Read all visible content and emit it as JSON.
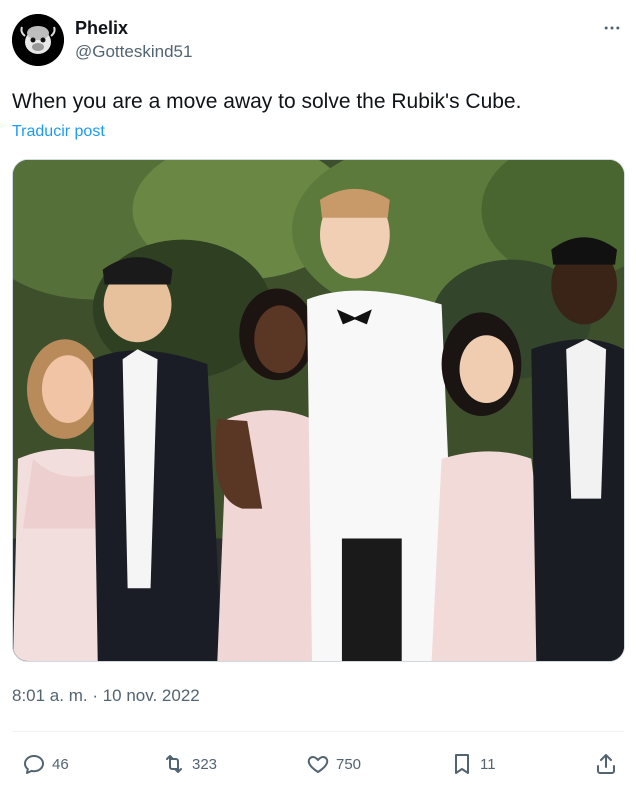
{
  "author": {
    "name": "Phelix",
    "handle": "@Gotteskind51",
    "avatar_icon": "gorilla-icon"
  },
  "tweet": {
    "text": "When you are a move away to solve the Rubik's Cube.",
    "translate_label": "Traducir post",
    "timestamp": "8:01 a. m. · 10 nov. 2022"
  },
  "media": {
    "icon": "prom-group-photo"
  },
  "actions": {
    "replies": "46",
    "retweets": "323",
    "likes": "750",
    "bookmarks": "11"
  },
  "colors": {
    "text": "#0f1419",
    "secondary": "#536471",
    "link": "#1d9bf0",
    "border": "#eff3f4"
  }
}
